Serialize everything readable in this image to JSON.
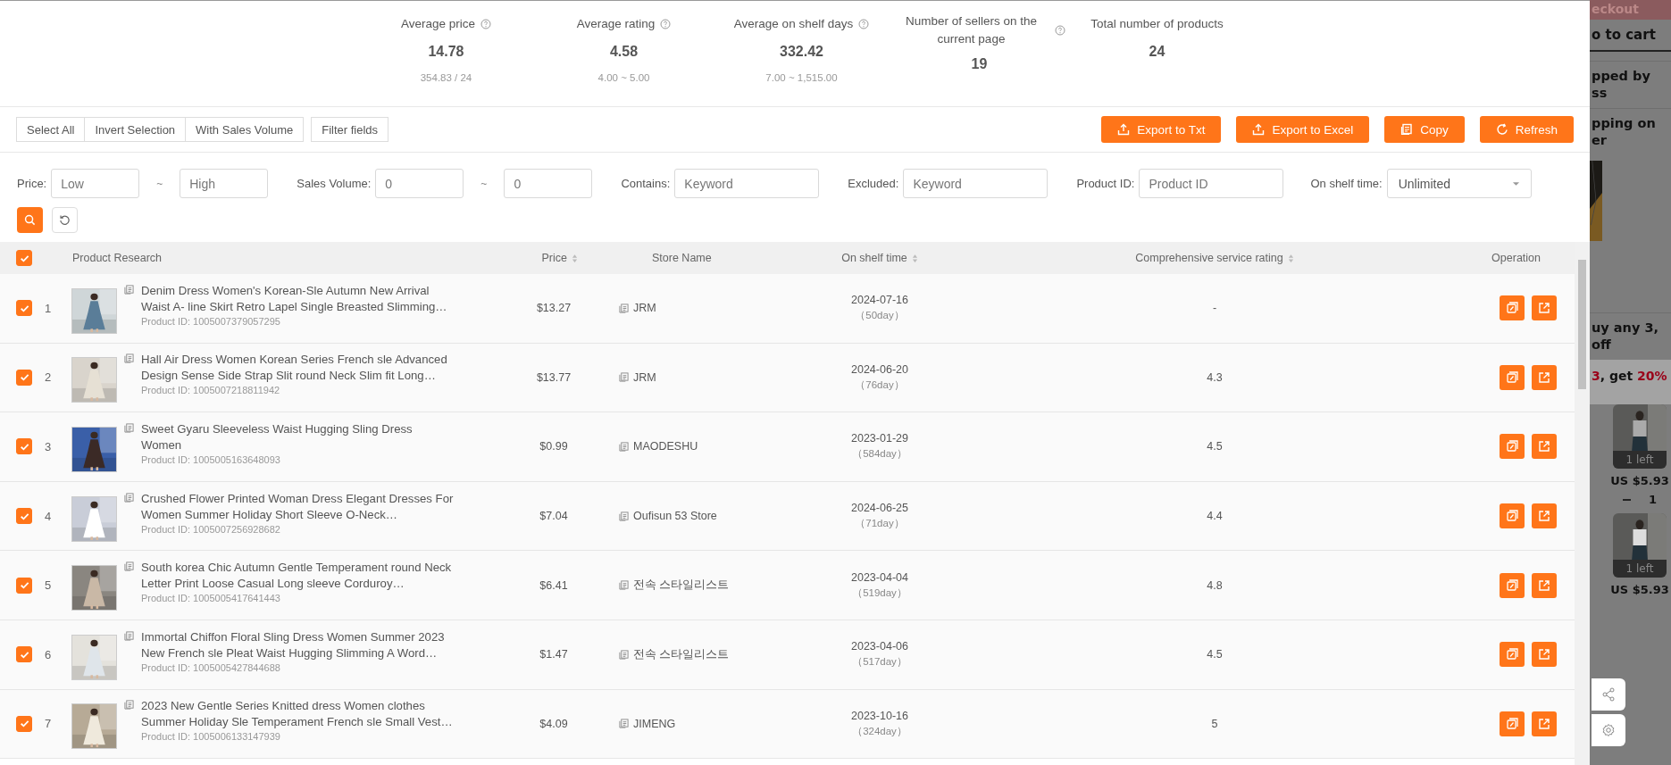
{
  "stats": [
    {
      "label": "Average price",
      "value": "14.78",
      "sub": "354.83 / 24",
      "help": true
    },
    {
      "label": "Average rating",
      "value": "4.58",
      "sub": "4.00 ~ 5.00",
      "help": true
    },
    {
      "label": "Average on shelf days",
      "value": "332.42",
      "sub": "7.00 ~ 1,515.00",
      "help": true
    },
    {
      "label": "Number of sellers on the current page",
      "value": "19",
      "help": true
    },
    {
      "label": "Total number of products",
      "value": "24",
      "help": false
    }
  ],
  "selection_buttons": [
    "Select All",
    "Invert Selection",
    "With Sales Volume"
  ],
  "filter_fields_button": "Filter fields",
  "actions": [
    {
      "label": "Export to Txt",
      "kind": "export"
    },
    {
      "label": "Export to Excel",
      "kind": "export"
    },
    {
      "label": "Copy",
      "kind": "copy"
    },
    {
      "label": "Refresh",
      "kind": "refresh"
    }
  ],
  "filters": [
    {
      "kind": "range",
      "label": "Price:",
      "from": {
        "placeholder": "Low"
      },
      "to": {
        "placeholder": "High"
      },
      "separator": "~"
    },
    {
      "kind": "range",
      "label": "Sales Volume:",
      "from": {
        "placeholder": "0"
      },
      "to": {
        "placeholder": "0"
      },
      "separator": "~"
    },
    {
      "kind": "text",
      "label": "Contains:",
      "placeholder": "Keyword"
    },
    {
      "kind": "text",
      "label": "Excluded:",
      "placeholder": "Keyword"
    },
    {
      "kind": "text",
      "label": "Product ID:",
      "placeholder": "Product ID"
    },
    {
      "kind": "select",
      "label": "On shelf time:",
      "value": "Unlimited"
    }
  ],
  "table": {
    "all_checked": true,
    "columns": [
      {
        "label": "Product Research",
        "sortable": false
      },
      {
        "label": "Price",
        "sortable": true
      },
      {
        "label": "Store Name",
        "sortable": false
      },
      {
        "label": "On shelf time",
        "sortable": true
      },
      {
        "label": "Comprehensive service rating",
        "sortable": true
      },
      {
        "label": "Operation",
        "sortable": false
      }
    ],
    "rows": [
      {
        "checked": true,
        "index": "1",
        "title": "Denim Dress Women's Korean-Sle Autumn New Arrival Waist A- line Skirt Retro Lapel Single Breasted Slimming…",
        "product_id": "Product ID: 1005007379057295",
        "price": "$13.27",
        "store": "JRM",
        "date": "2024-07-16",
        "days": "（50day）",
        "rating": "-"
      },
      {
        "checked": true,
        "index": "2",
        "title": "Hall Air Dress Women Korean Series French sle Advanced Design Sense Side Strap Slit round Neck Slim fit Long…",
        "product_id": "Product ID: 1005007218811942",
        "price": "$13.77",
        "store": "JRM",
        "date": "2024-06-20",
        "days": "（76day）",
        "rating": "4.3"
      },
      {
        "checked": true,
        "index": "3",
        "title": "Sweet Gyaru Sleeveless Waist Hugging Sling Dress Women",
        "product_id": "Product ID: 1005005163648093",
        "price": "$0.99",
        "store": "MAODESHU",
        "date": "2023-01-29",
        "days": "（584day）",
        "rating": "4.5"
      },
      {
        "checked": true,
        "index": "4",
        "title": "Crushed Flower Printed Woman Dress Elegant Dresses For Women Summer Holiday Short Sleeve O-Neck…",
        "product_id": "Product ID: 1005007256928682",
        "price": "$7.04",
        "store": "Oufisun 53 Store",
        "date": "2024-06-25",
        "days": "（71day）",
        "rating": "4.4"
      },
      {
        "checked": true,
        "index": "5",
        "title": "South korea Chic Autumn Gentle Temperament round Neck Letter Print Loose Casual Long sleeve Corduroy…",
        "product_id": "Product ID: 1005005417641443",
        "price": "$6.41",
        "store": "전속 스타일리스트",
        "date": "2023-04-04",
        "days": "（519day）",
        "rating": "4.8"
      },
      {
        "checked": true,
        "index": "6",
        "title": "Immortal Chiffon Floral Sling Dress Women Summer 2023 New French sle Pleat Waist Hugging Slimming A Word…",
        "product_id": "Product ID: 1005005427844688",
        "price": "$1.47",
        "store": "전속 스타일리스트",
        "date": "2023-04-06",
        "days": "（517day）",
        "rating": "4.5"
      },
      {
        "checked": true,
        "index": "7",
        "title": "2023 New Gentle Series Knitted dress Women clothes Summer Holiday Sle Temperament French sle Small Vest…",
        "product_id": "Product ID: 1005006133147939",
        "price": "$4.09",
        "store": "JIMENG",
        "date": "2023-10-16",
        "days": "（324day）",
        "rating": "5"
      }
    ]
  },
  "background_page": {
    "checkout": "eckout",
    "cart": "o to cart",
    "shipped": [
      "pped by",
      "ss"
    ],
    "shipping": [
      "pping on",
      "er"
    ],
    "promo": [
      "uy any 3,",
      "off"
    ],
    "promo_count": "3",
    "promo_text": ", get ",
    "promo_discount": "20%",
    "cards": [
      {
        "stock": "1 left",
        "price": "US $5.93",
        "qty": "1"
      },
      {
        "stock": "1 left",
        "price": "US $5.93"
      }
    ]
  }
}
